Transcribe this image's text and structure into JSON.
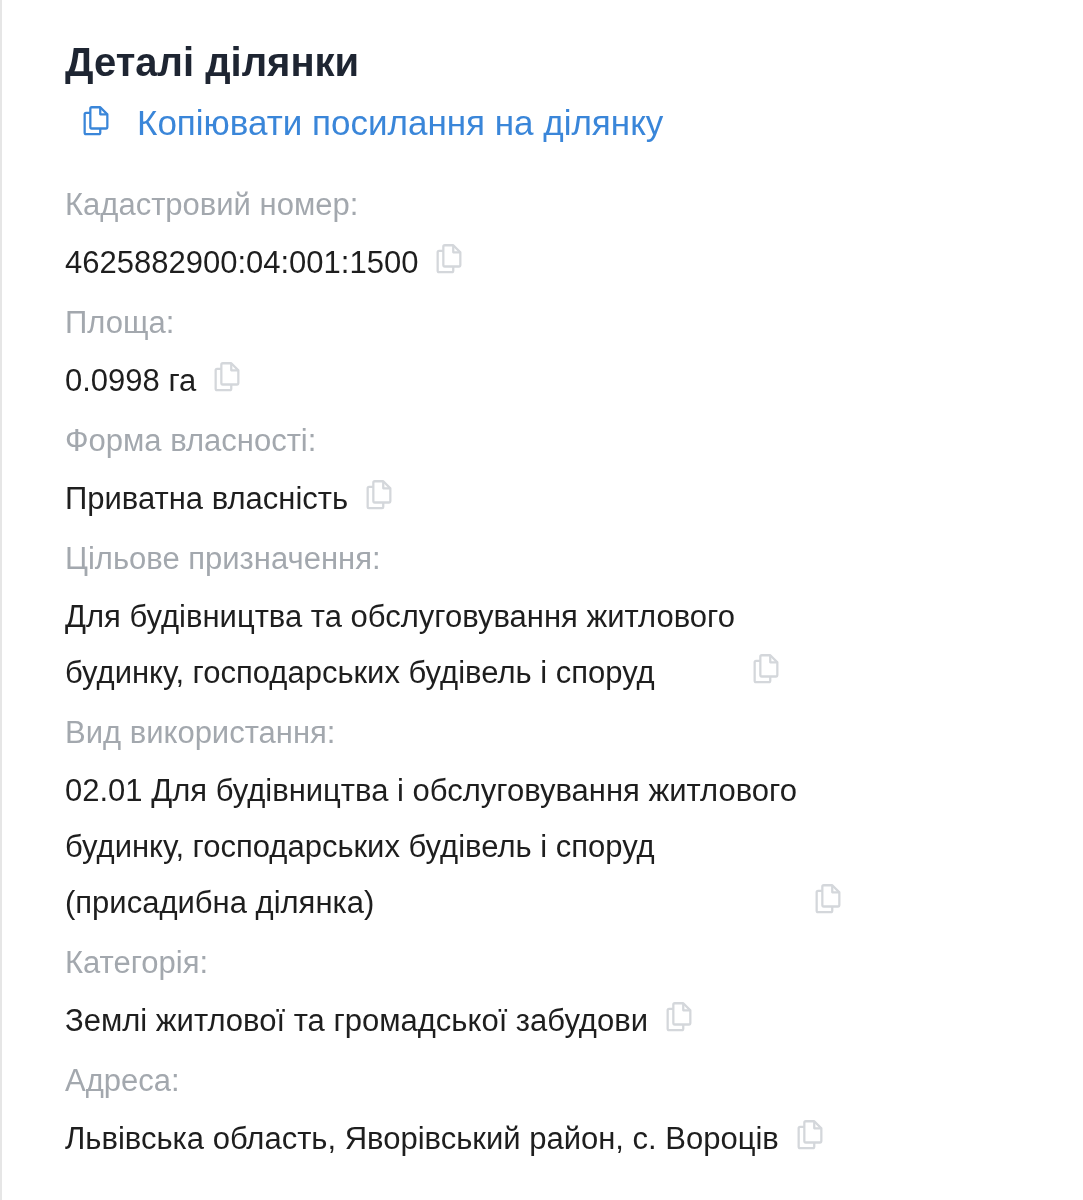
{
  "title": "Деталі ділянки",
  "copy_link": {
    "label": "Копіювати посилання на ділянку"
  },
  "fields": [
    {
      "label": "Кадастровий номер:",
      "value": "4625882900:04:001:1500"
    },
    {
      "label": "Площа:",
      "value": "0.0998 га"
    },
    {
      "label": "Форма власності:",
      "value": "Приватна власність"
    },
    {
      "label": "Цільове призначення:",
      "value": "Для будівництва та обслуговування житлового\nбудинку, господарських будівель і споруд"
    },
    {
      "label": "Вид використання:",
      "value": "02.01 Для будівництва і обслуговування житлового\nбудинку, господарських будівель і споруд\n(присадибна ділянка)"
    },
    {
      "label": "Категорія:",
      "value": "Землі житлової та громадської забудови"
    },
    {
      "label": "Адреса:",
      "value": "Львівська область, Яворівський район, с. Вороців"
    }
  ]
}
